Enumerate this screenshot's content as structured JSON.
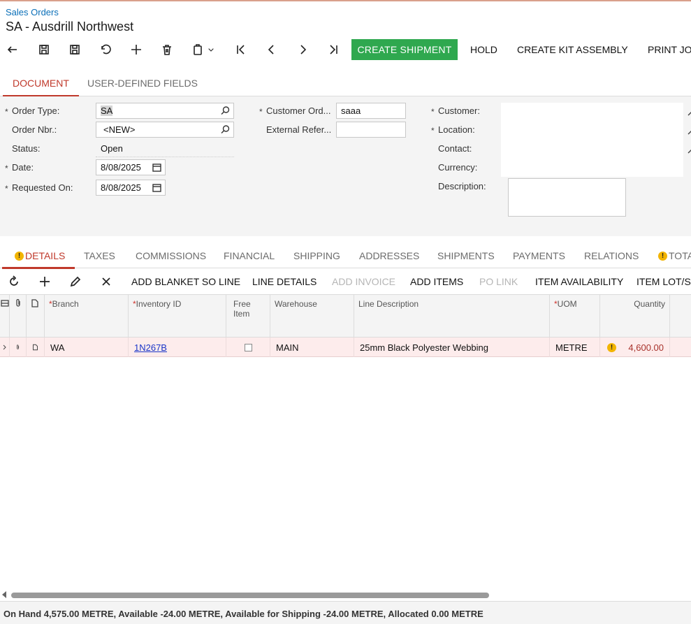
{
  "header": {
    "breadcrumb": "Sales Orders",
    "title": "SA - Ausdrill Northwest"
  },
  "toolbar": {
    "icons": [
      "undo-arrow-icon",
      "save-close-icon",
      "save-icon",
      "cancel-icon",
      "add-icon",
      "delete-icon",
      "copy-paste-icon",
      "chevron-down-icon",
      "first-record-icon",
      "previous-record-icon",
      "next-record-icon",
      "last-record-icon"
    ],
    "create_shipment": "CREATE SHIPMENT",
    "hold": "HOLD",
    "create_kit_assembly": "CREATE KIT ASSEMBLY",
    "print_job": "PRINT JO",
    "accent_color": "#2fa84f"
  },
  "form_tabs": [
    "DOCUMENT",
    "USER-DEFINED FIELDS"
  ],
  "form": {
    "order_type_label": "Order Type:",
    "order_type_value": "SA",
    "order_nbr_label": "Order Nbr.:",
    "order_nbr_value": "<NEW>",
    "status_label": "Status:",
    "status_value": "Open",
    "date_label": "Date:",
    "date_value": "8/08/2025",
    "requested_on_label": "Requested On:",
    "requested_on_value": "8/08/2025",
    "customer_order_label": "Customer Ord...",
    "customer_order_value": "saaa",
    "external_ref_label": "External Refer...",
    "external_ref_value": "",
    "customer_label": "Customer:",
    "location_label": "Location:",
    "contact_label": "Contact:",
    "currency_label": "Currency:",
    "description_label": "Description:",
    "required_mark": "*"
  },
  "grid_tabs": [
    "DETAILS",
    "TAXES",
    "COMMISSIONS",
    "FINANCIAL",
    "SHIPPING",
    "ADDRESSES",
    "SHIPMENTS",
    "PAYMENTS",
    "RELATIONS",
    "TOTA"
  ],
  "warning_glyph": "!",
  "grid_toolbar": {
    "add_blanket_so_line": "ADD BLANKET SO LINE",
    "line_details": "LINE DETAILS",
    "add_invoice": "ADD INVOICE",
    "add_items": "ADD ITEMS",
    "po_link": "PO LINK",
    "item_availability": "ITEM AVAILABILITY",
    "item_lot": "ITEM LOT/SE"
  },
  "grid": {
    "columns": {
      "branch": "Branch",
      "inventory_id": "Inventory ID",
      "free_item_1": "Free",
      "free_item_2": "Item",
      "warehouse": "Warehouse",
      "line_description": "Line Description",
      "uom": "UOM",
      "quantity": "Quantity"
    },
    "rows": [
      {
        "branch": "WA",
        "inventory_id": "1N267B",
        "free_item": false,
        "warehouse": "MAIN",
        "line_description": "25mm Black Polyester Webbing",
        "uom": "METRE",
        "quantity": "4,600.00"
      }
    ]
  },
  "status_bar": "On Hand 4,575.00 METRE, Available -24.00 METRE, Available for Shipping -24.00 METRE, Allocated 0.00 METRE"
}
